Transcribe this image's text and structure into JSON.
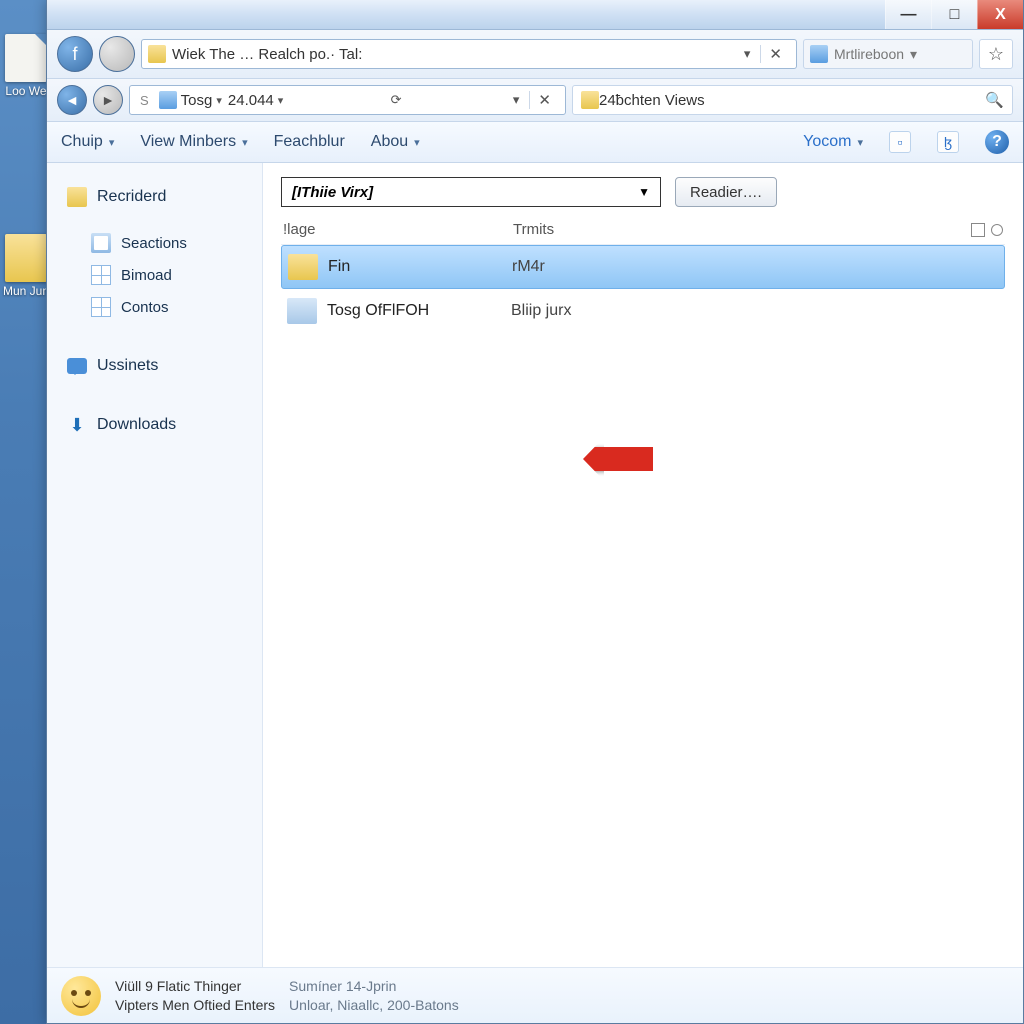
{
  "desktop": {
    "icons": [
      {
        "label": "Loo\nWe"
      },
      {
        "label": "Mun\nJun"
      }
    ]
  },
  "window_controls": {
    "min": "—",
    "max": "□",
    "close": "X"
  },
  "address_row1": {
    "path_text": "Wiek The … Realch po.· Tal:",
    "side_label": "Mrtlireboon"
  },
  "address_row2": {
    "prefix": "S",
    "seg1": "Tosg",
    "seg2": "24.044",
    "search_label": "24ƀchten Views"
  },
  "menubar": {
    "items": [
      {
        "label": "Chuip",
        "dropdown": true
      },
      {
        "label": "View Minbers",
        "dropdown": true
      },
      {
        "label": "Feachblur",
        "dropdown": false
      },
      {
        "label": "Abou",
        "dropdown": true
      }
    ],
    "right_link": "Yocom"
  },
  "sidebar": {
    "root": "Recriderd",
    "subs": [
      "Seactions",
      "Bimoad",
      "Contos"
    ],
    "group2": "Ussinets",
    "group3": "Downloads"
  },
  "content": {
    "combo_value": "[IThiie Virx]",
    "button_label": "Readier….",
    "columns": {
      "c1": "!lage",
      "c2": "Trmits"
    },
    "rows": [
      {
        "name": "Fin",
        "col2": "rM4r",
        "selected": true,
        "icon": "folder"
      },
      {
        "name": "Tosg OfFlFOH",
        "col2": "Bliip jurx",
        "selected": false,
        "icon": "doc"
      }
    ]
  },
  "statusbar": {
    "l1": "Viüll    9 Flatic Thinger",
    "l2": "Vipters Men Oftied Enters",
    "r1": "Sumíner 14-Jprin",
    "r2": "Unloar, Niaallc, 200-Batons"
  }
}
